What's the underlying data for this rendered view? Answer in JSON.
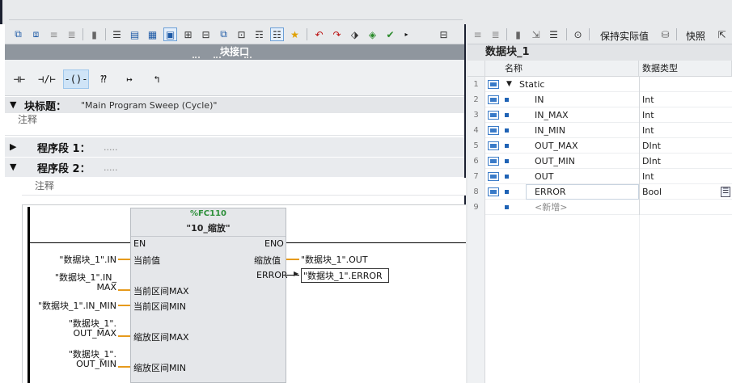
{
  "left_editor": {
    "interface_bar_label": "块接口",
    "block_title_label": "块标题：",
    "block_title_value": "\"Main Program Sweep (Cycle)\"",
    "block_comment": "注释",
    "network1": {
      "label": "程序段 1：",
      "dots": "....."
    },
    "network2": {
      "label": "程序段 2：",
      "dots": "....."
    },
    "network2_comment": "注释",
    "instructions": [
      {
        "name": "no-contact",
        "glyph": "⊣⊢"
      },
      {
        "name": "nc-contact",
        "glyph": "⊣/⊢"
      },
      {
        "name": "coil",
        "glyph": "-()-"
      },
      {
        "name": "empty-box",
        "glyph": "⁇"
      },
      {
        "name": "open-branch",
        "glyph": "↦"
      },
      {
        "name": "close-branch",
        "glyph": "↰"
      }
    ]
  },
  "fb_block": {
    "number": "%FC110",
    "name": "\"10_缩放\"",
    "en": "EN",
    "eno": "ENO",
    "inputs": [
      {
        "pin": "当前值",
        "operand": "\"数据块_1\".IN"
      },
      {
        "pin": "当前区间MAX",
        "operand_line1": "\"数据块_1\".IN_",
        "operand_line2": "MAX"
      },
      {
        "pin": "当前区间MIN",
        "operand": "\"数据块_1\".IN_MIN"
      },
      {
        "pin": "缩放区间MAX",
        "operand_line1": "\"数据块_1\".",
        "operand_line2": "OUT_MAX"
      },
      {
        "pin": "缩放区间MIN",
        "operand_line1": "\"数据块_1\".",
        "operand_line2": "OUT_MIN"
      }
    ],
    "outputs": [
      {
        "pin": "缩放值",
        "operand": "\"数据块_1\".OUT"
      },
      {
        "pin": "ERROR",
        "operand": "\"数据块_1\".ERROR"
      }
    ]
  },
  "right_editor": {
    "toolbar_keep_actual": "保持实际值",
    "toolbar_snapshot": "快照",
    "title": "数据块_1",
    "col_name": "名称",
    "col_type": "数据类型",
    "rows": [
      {
        "num": "1",
        "name": "Static",
        "type": "",
        "expander": "▼"
      },
      {
        "num": "2",
        "name": "IN",
        "type": "Int"
      },
      {
        "num": "3",
        "name": "IN_MAX",
        "type": "Int"
      },
      {
        "num": "4",
        "name": "IN_MIN",
        "type": "Int"
      },
      {
        "num": "5",
        "name": "OUT_MAX",
        "type": "DInt"
      },
      {
        "num": "6",
        "name": "OUT_MIN",
        "type": "DInt"
      },
      {
        "num": "7",
        "name": "OUT",
        "type": "Int"
      },
      {
        "num": "8",
        "name": "ERROR",
        "type": "Bool"
      },
      {
        "num": "9",
        "name": "<新增>",
        "type": ""
      }
    ]
  },
  "colors": {
    "highlight_wire": "#e69a1c",
    "block_fill": "#e5e7ea",
    "fc_number": "#2d8f3a",
    "section_bar": "#8f969e"
  }
}
